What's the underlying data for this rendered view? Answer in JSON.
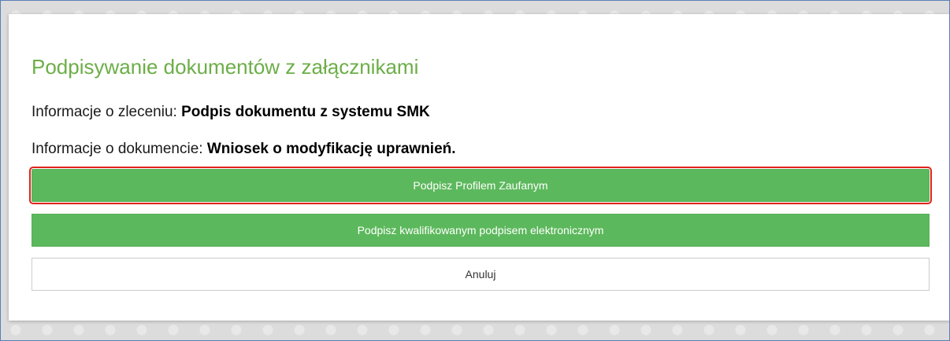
{
  "dialog": {
    "title": "Podpisywanie dokumentów z załącznikami",
    "order_info": {
      "label": "Informacje o zleceniu: ",
      "value": "Podpis dokumentu z systemu SMK"
    },
    "document_info": {
      "label": "Informacje o dokumencie: ",
      "value": "Wniosek o modyfikację uprawnień."
    },
    "buttons": {
      "trusted_profile": "Podpisz Profilem Zaufanym",
      "qualified_signature": "Podpisz kwalifikowanym podpisem elektronicznym",
      "cancel": "Anuluj"
    }
  },
  "colors": {
    "title": "#6cae47",
    "primary_button": "#5cb85c",
    "highlight_outline": "#e2231a"
  }
}
